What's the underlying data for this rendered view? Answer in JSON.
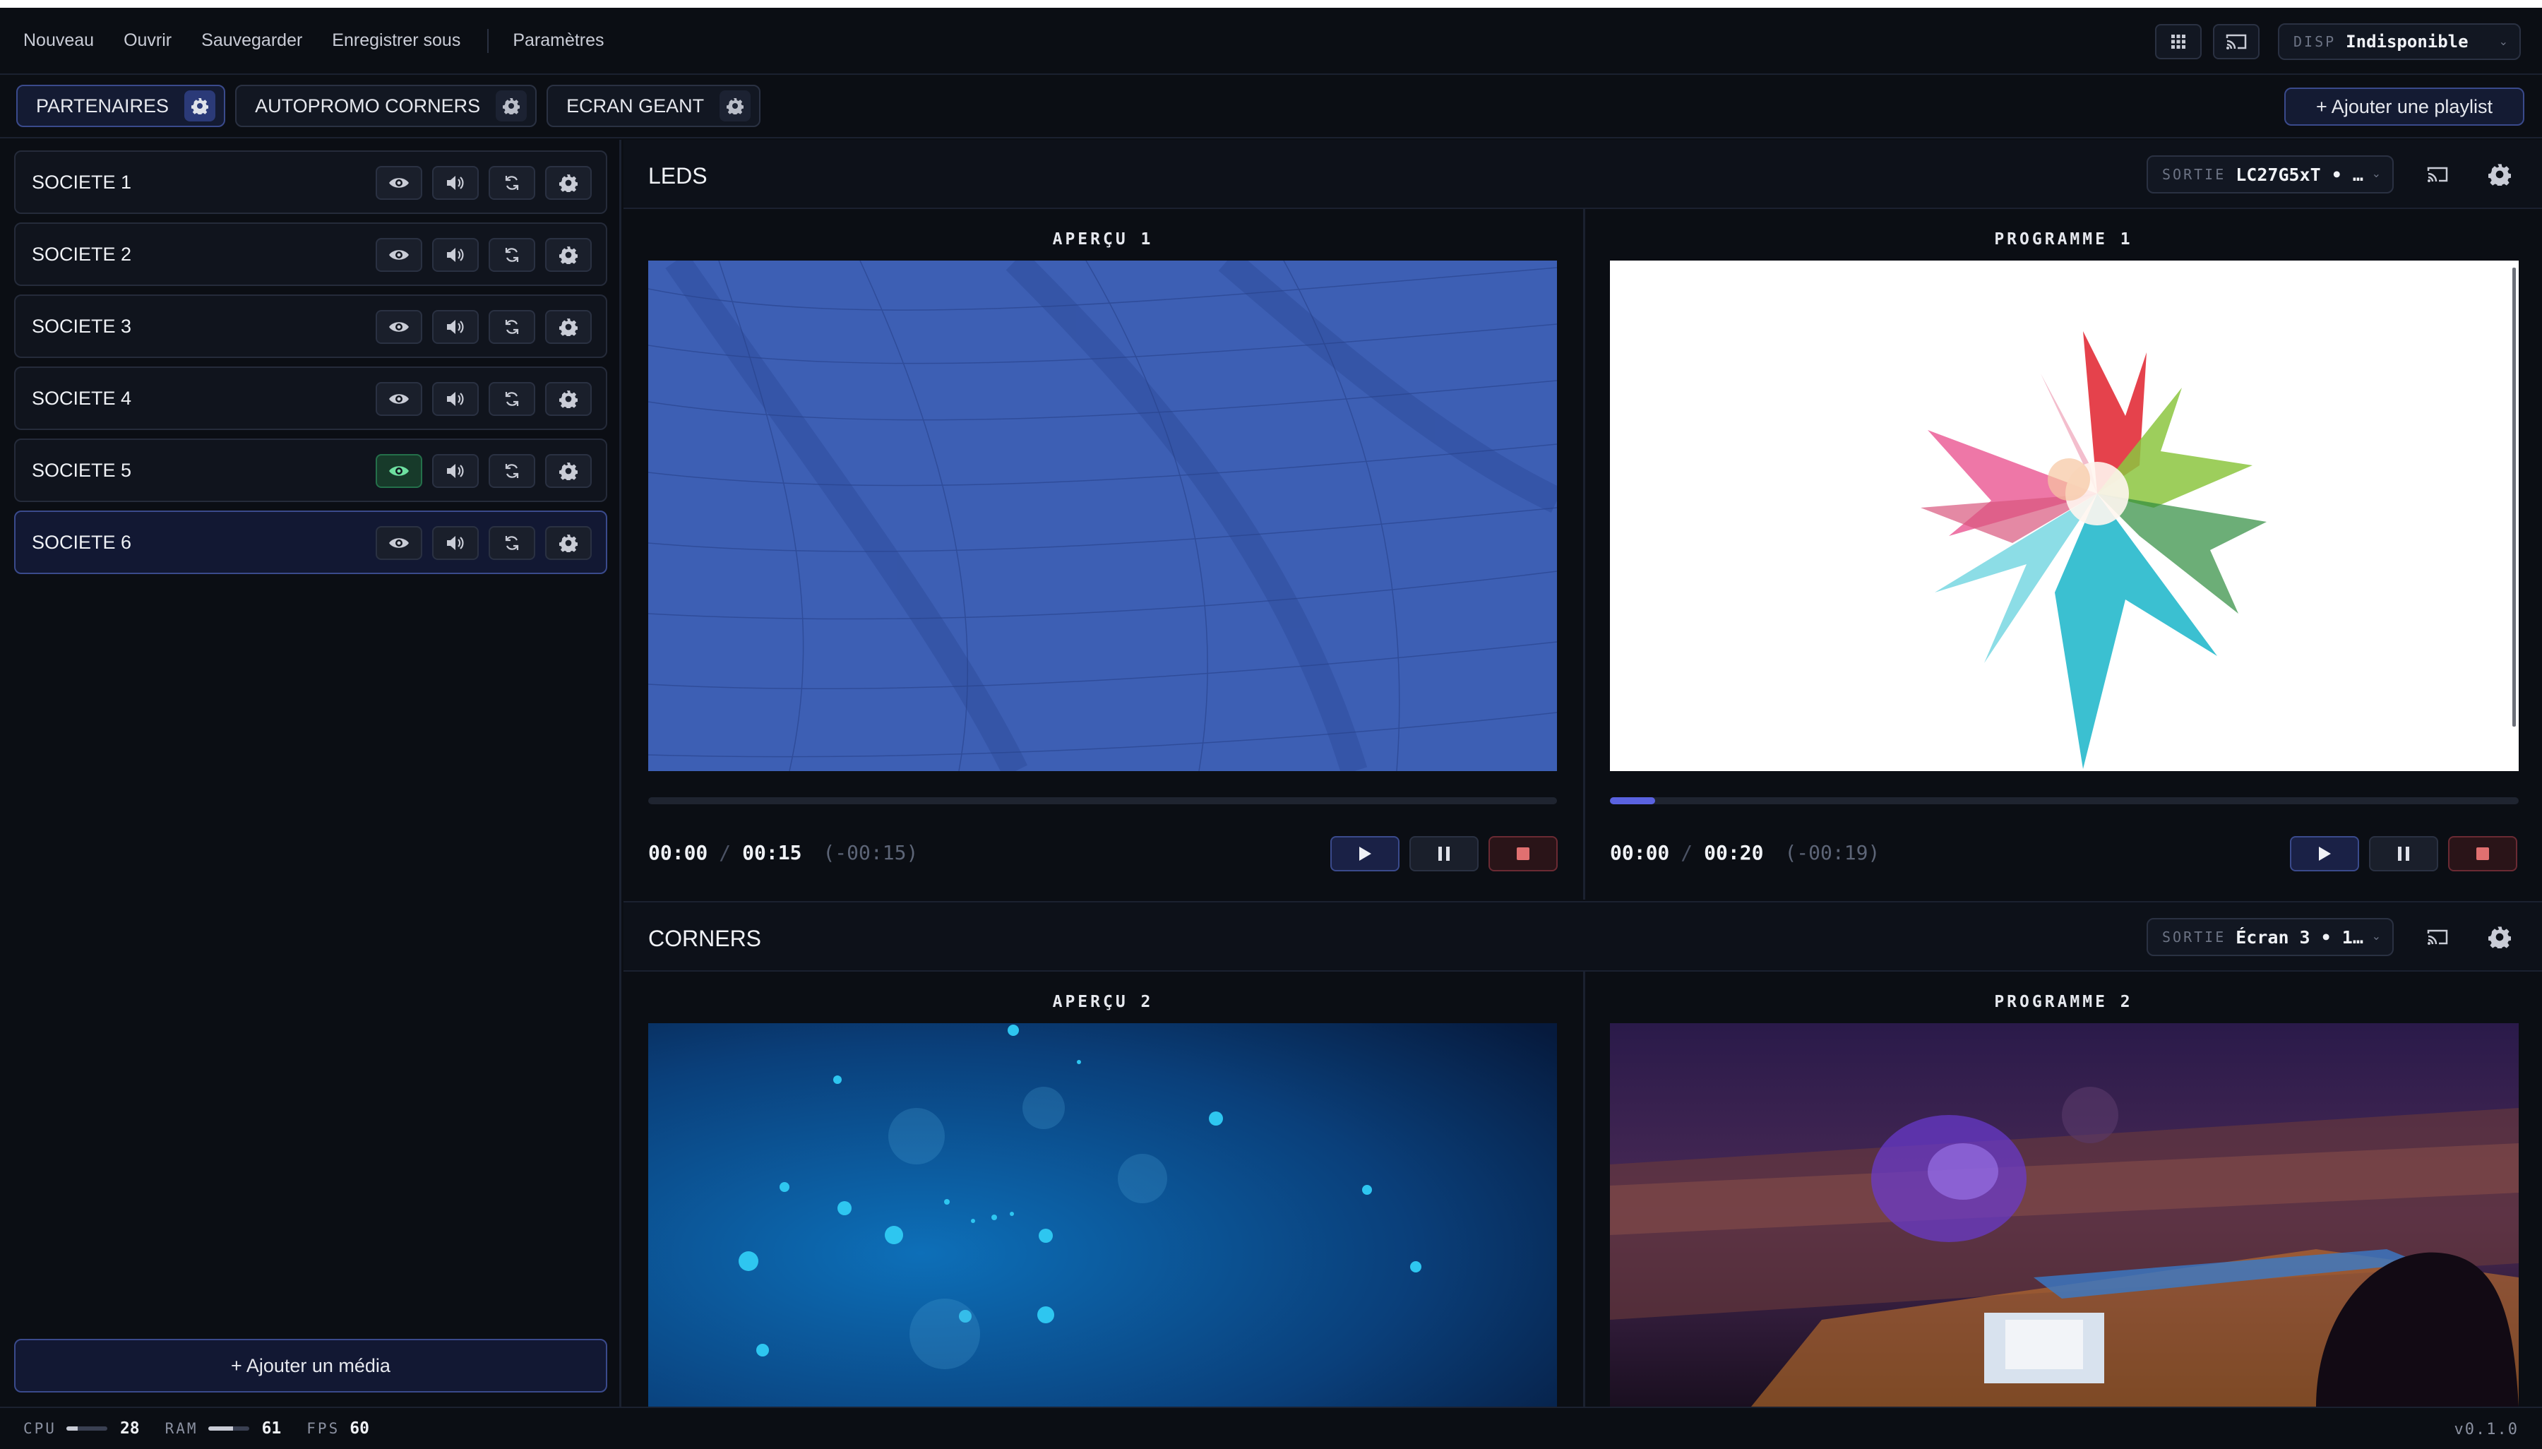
{
  "menu": {
    "items": [
      "Nouveau",
      "Ouvrir",
      "Sauvegarder",
      "Enregistrer sous"
    ],
    "settings": "Paramètres"
  },
  "display": {
    "label": "DISP",
    "value": "Indisponible"
  },
  "playlists": [
    {
      "label": "PARTENAIRES",
      "active": true
    },
    {
      "label": "AUTOPROMO CORNERS",
      "active": false
    },
    {
      "label": "ECRAN GEANT",
      "active": false
    }
  ],
  "add_playlist": "+ Ajouter une playlist",
  "media": [
    {
      "name": "SOCIETE 1",
      "visible_on": false
    },
    {
      "name": "SOCIETE 2",
      "visible_on": false
    },
    {
      "name": "SOCIETE 3",
      "visible_on": false
    },
    {
      "name": "SOCIETE 4",
      "visible_on": false
    },
    {
      "name": "SOCIETE 5",
      "visible_on": true
    },
    {
      "name": "SOCIETE 6",
      "visible_on": false,
      "selected": true
    }
  ],
  "add_media": "+ Ajouter un média",
  "sections": [
    {
      "title": "LEDS",
      "sortie_label": "SORTIE",
      "sortie_value": "LC27G5xT • …",
      "preview": {
        "title": "APERÇU 1",
        "current": "00:00",
        "total": "00:15",
        "remaining": "(-00:15)",
        "progress": 0
      },
      "program": {
        "title": "PROGRAMME 1",
        "current": "00:00",
        "total": "00:20",
        "remaining": "(-00:19)",
        "progress": 0.05
      }
    },
    {
      "title": "CORNERS",
      "sortie_label": "SORTIE",
      "sortie_value": "Écran 3 • 1…",
      "preview": {
        "title": "APERÇU 2"
      },
      "program": {
        "title": "PROGRAMME 2"
      }
    }
  ],
  "status": {
    "cpu_label": "CPU",
    "cpu": "28",
    "ram_label": "RAM",
    "ram": "61",
    "fps_label": "FPS",
    "fps": "60",
    "version": "v0.1.0"
  },
  "colors": {
    "accent": "#5a62e0",
    "active_border": "#3a4a8c",
    "eye_on": "#24704a",
    "stop": "#e07070"
  }
}
